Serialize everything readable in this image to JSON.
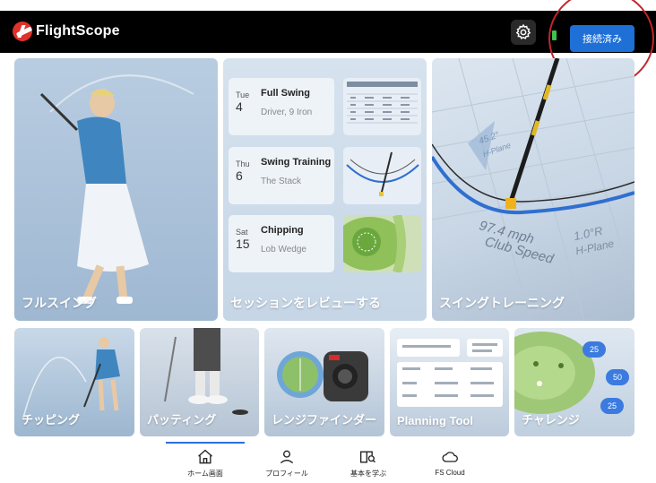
{
  "header": {
    "logo_text": "FlightScope",
    "connect_label": "接続済み",
    "icons": {
      "settings": "gear-icon",
      "battery": "battery-icon"
    },
    "colors": {
      "bar": "#000000",
      "accent": "#1e6fd6",
      "battery": "#3ec34a"
    }
  },
  "tiles": {
    "full_swing": "フルスイング",
    "review": "セッションをレビューする",
    "swing_training": "スイングトレーニング",
    "chipping": "チッピング",
    "putting": "パッティング",
    "rangefinder": "レンジファインダー",
    "planning_tool": "Planning Tool",
    "challenge": "チャレンジ"
  },
  "sessions": [
    {
      "day": "Tue",
      "date": "4",
      "title": "Full Swing",
      "subtitle": "Driver, 9 Iron"
    },
    {
      "day": "Thu",
      "date": "6",
      "title": "Swing Training",
      "subtitle": "The Stack"
    },
    {
      "day": "Sat",
      "date": "15",
      "title": "Chipping",
      "subtitle": "Lob Wedge"
    }
  ],
  "training_overlay": {
    "speed": "97.4 mph",
    "speed_label": "Club Speed",
    "angle": "1.0°R",
    "angle_label": "H-Plane",
    "plane": "45.2°",
    "plane_label": "H-Plane"
  },
  "challenge_badges": [
    "25",
    "50",
    "25"
  ],
  "tabbar": [
    {
      "label": "ホーム画面",
      "icon": "home-icon",
      "active": true
    },
    {
      "label": "プロフィール",
      "icon": "profile-icon",
      "active": false
    },
    {
      "label": "基本を学ぶ",
      "icon": "learn-book-icon",
      "active": false
    },
    {
      "label": "FS Cloud",
      "icon": "cloud-icon",
      "active": false
    }
  ]
}
